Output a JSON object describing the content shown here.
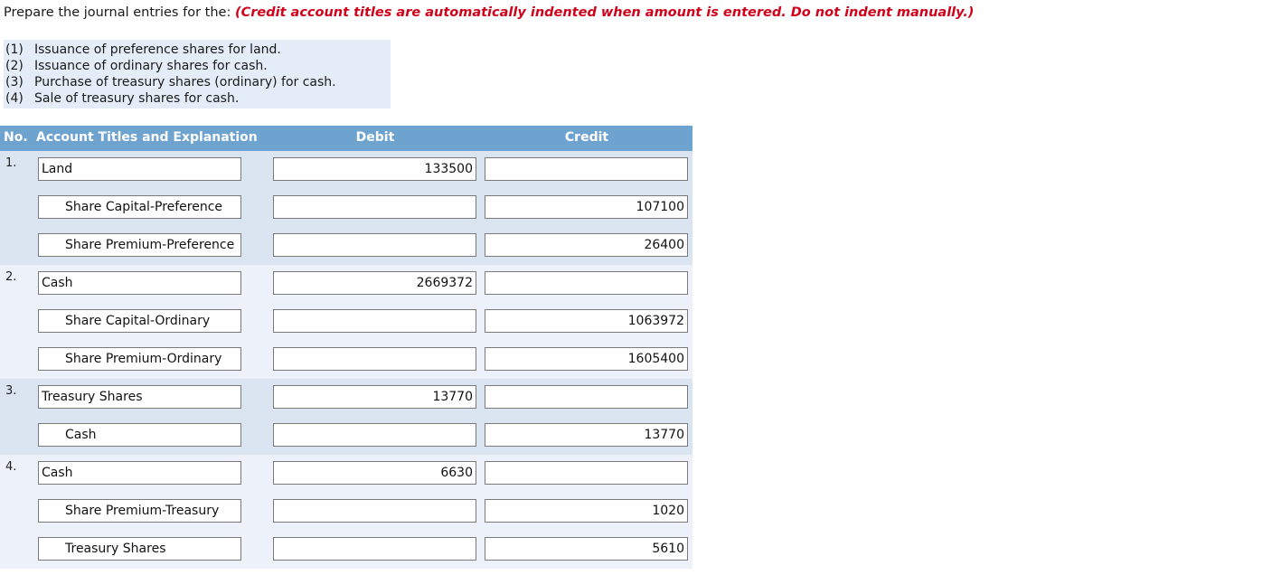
{
  "prompt": {
    "lead": "Prepare the journal entries for the:",
    "note": "(Credit account titles are automatically indented when amount is entered. Do not indent manually.)",
    "note_color": "#d0021b"
  },
  "requirements": [
    {
      "num": "(1)",
      "text": "Issuance of preference shares for land."
    },
    {
      "num": "(2)",
      "text": "Issuance of ordinary shares for cash."
    },
    {
      "num": "(3)",
      "text": "Purchase of treasury shares (ordinary) for cash."
    },
    {
      "num": "(4)",
      "text": "Sale of treasury shares for cash."
    }
  ],
  "table": {
    "header": {
      "no": "No.",
      "account": "Account Titles and Explanation",
      "debit": "Debit",
      "credit": "Credit",
      "bg_color": "#6fa3cf",
      "text_color": "#ffffff"
    },
    "entries": [
      {
        "num": "1.",
        "band": "dark",
        "lines": [
          {
            "account": "Land",
            "indented": false,
            "debit": "133500",
            "credit": ""
          },
          {
            "account": "Share Capital-Preference",
            "indented": true,
            "debit": "",
            "credit": "107100"
          },
          {
            "account": "Share Premium-Preference",
            "indented": true,
            "debit": "",
            "credit": "26400"
          }
        ]
      },
      {
        "num": "2.",
        "band": "light",
        "lines": [
          {
            "account": "Cash",
            "indented": false,
            "debit": "2669372",
            "credit": ""
          },
          {
            "account": "Share Capital-Ordinary",
            "indented": true,
            "debit": "",
            "credit": "1063972"
          },
          {
            "account": "Share Premium-Ordinary",
            "indented": true,
            "debit": "",
            "credit": "1605400"
          }
        ]
      },
      {
        "num": "3.",
        "band": "dark",
        "lines": [
          {
            "account": "Treasury Shares",
            "indented": false,
            "debit": "13770",
            "credit": ""
          },
          {
            "account": "Cash",
            "indented": true,
            "debit": "",
            "credit": "13770"
          }
        ]
      },
      {
        "num": "4.",
        "band": "light",
        "lines": [
          {
            "account": "Cash",
            "indented": false,
            "debit": "6630",
            "credit": ""
          },
          {
            "account": "Share Premium-Treasury",
            "indented": true,
            "debit": "",
            "credit": "1020"
          },
          {
            "account": "Treasury Shares",
            "indented": true,
            "debit": "",
            "credit": "5610"
          }
        ]
      }
    ]
  }
}
